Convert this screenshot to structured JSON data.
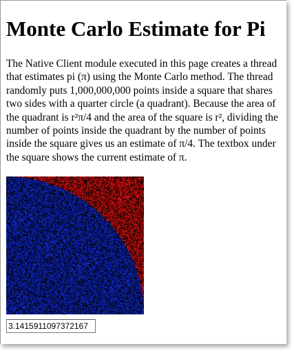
{
  "page": {
    "title": "Monte Carlo Estimate for Pi",
    "description": "The Native Client module executed in this page creates a thread that estimates pi (π) using the Monte Carlo method. The thread randomly puts 1,000,000,000 points inside a square that shares two sides with a quarter circle (a quadrant). Because the area of the quadrant is r²π/4 and the area of the square is r², dividing the number of points inside the quadrant by the number of points inside the square gives us an estimate of π/4. The textbox under the square shows the current estimate of π."
  },
  "simulation": {
    "inside_color": "#1028c8",
    "outside_color": "#d81010",
    "background_color": "#000000"
  },
  "estimate": {
    "value": "3.1415911097372167"
  }
}
